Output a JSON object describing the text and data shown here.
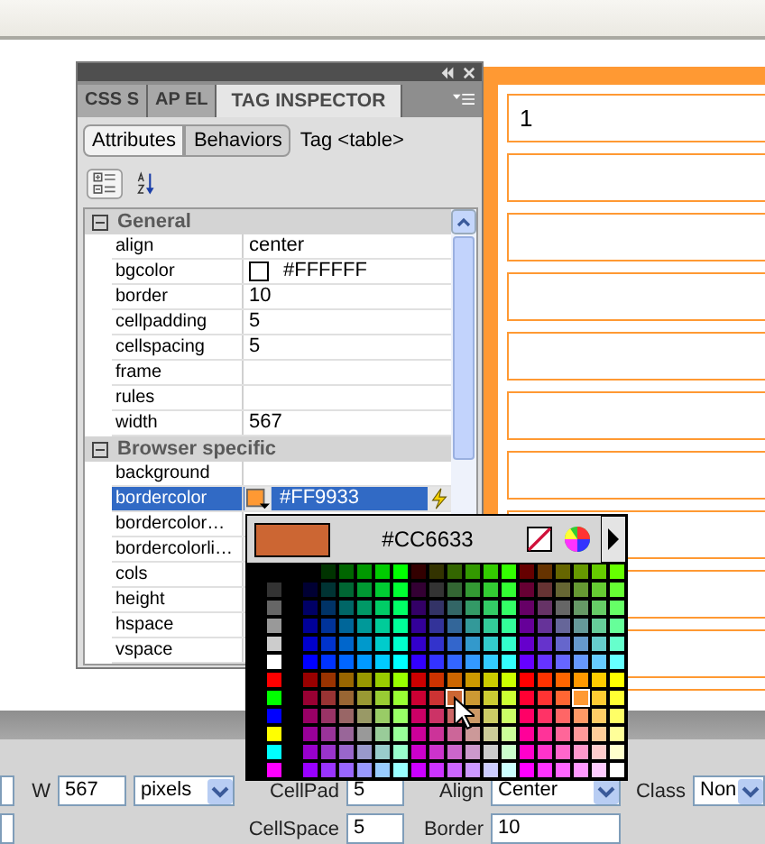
{
  "panel": {
    "tabs": [
      {
        "label": "CSS S",
        "selected": false
      },
      {
        "label": "AP EL",
        "selected": false
      },
      {
        "label": "TAG INSPECTOR",
        "selected": true
      }
    ],
    "subtabs": [
      {
        "label": "Attributes",
        "selected": true
      },
      {
        "label": "Behaviors",
        "selected": false
      }
    ],
    "tag_label": "Tag <table>",
    "sections": [
      {
        "title": "General",
        "expanded": true,
        "rows": [
          {
            "name": "align",
            "value": "center",
            "selected": false
          },
          {
            "name": "bgcolor",
            "value": "#FFFFFF",
            "color": "#ffffff",
            "selected": false
          },
          {
            "name": "border",
            "value": "10",
            "selected": false
          },
          {
            "name": "cellpadding",
            "value": "5",
            "selected": false
          },
          {
            "name": "cellspacing",
            "value": "5",
            "selected": false
          },
          {
            "name": "frame",
            "selected": false
          },
          {
            "name": "rules",
            "selected": false
          },
          {
            "name": "width",
            "value": "567",
            "selected": false
          }
        ]
      },
      {
        "title": "Browser specific",
        "expanded": true,
        "rows": [
          {
            "name": "background",
            "selected": false
          },
          {
            "name": "bordercolor",
            "value": "#FF9933",
            "color": "#ff9933",
            "selected": true
          },
          {
            "name": "bordercolor…",
            "selected": false
          },
          {
            "name": "bordercolorli…",
            "selected": false
          },
          {
            "name": "cols",
            "selected": false
          },
          {
            "name": "height",
            "selected": false
          },
          {
            "name": "hspace",
            "selected": false
          },
          {
            "name": "vspace",
            "selected": false
          }
        ]
      }
    ]
  },
  "color_picker": {
    "color": "#cc6633",
    "hex": "#CC6633"
  },
  "table": {
    "rows": [
      {
        "text": "1"
      },
      {},
      {},
      {},
      {},
      {},
      {},
      {},
      {},
      {},
      {}
    ]
  },
  "inspector": {
    "rows": [
      [
        {
          "kind": "input"
        },
        {
          "kind": "input",
          "label": "W",
          "value": "567"
        },
        {
          "kind": "select",
          "value": "pixels"
        },
        {
          "kind": "input",
          "label": "CellPad",
          "value": "5"
        },
        {
          "kind": "select",
          "label": "Align",
          "value": "Center"
        },
        {
          "kind": "select",
          "label": "Class",
          "value": "Non"
        }
      ],
      [
        {
          "kind": "input"
        },
        {
          "kind": "empty"
        },
        {
          "kind": "empty"
        },
        {
          "kind": "input",
          "label": "CellSpace",
          "value": "5"
        },
        {
          "kind": "input",
          "label": "Border",
          "value": "10"
        }
      ]
    ]
  }
}
